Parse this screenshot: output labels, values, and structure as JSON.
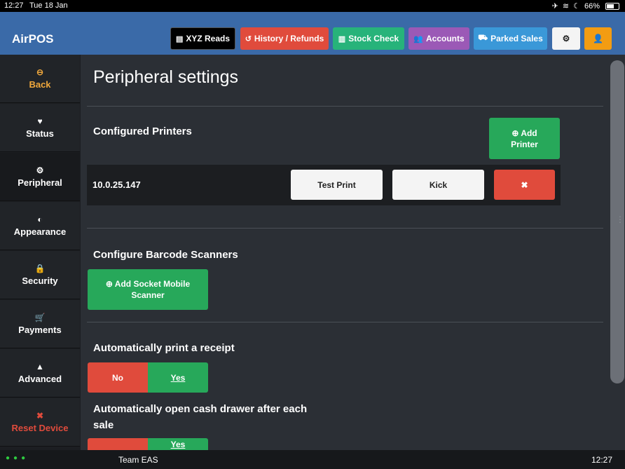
{
  "statusbar": {
    "time": "12:27",
    "date": "Tue 18 Jan",
    "battery": "66%"
  },
  "navbar": {
    "brand": "AirPOS",
    "buttons": [
      {
        "label": "XYZ Reads",
        "color": "#000000"
      },
      {
        "label": "History / Refunds",
        "color": "#e04b3c"
      },
      {
        "label": "Stock Check",
        "color": "#27b37a"
      },
      {
        "label": "Accounts",
        "color": "#9b59b6"
      },
      {
        "label": "Parked Sales",
        "color": "#3a98d8"
      }
    ]
  },
  "sidebar": {
    "items": [
      {
        "label": "Back",
        "icon": "circle-arrow-icon"
      },
      {
        "label": "Status",
        "icon": "heartbeat-icon"
      },
      {
        "label": "Peripheral",
        "icon": "gear-icon"
      },
      {
        "label": "Appearance",
        "icon": "half-circle-icon"
      },
      {
        "label": "Security",
        "icon": "lock-icon"
      },
      {
        "label": "Payments",
        "icon": "cart-icon"
      },
      {
        "label": "Advanced",
        "icon": "warning-icon"
      },
      {
        "label": "Reset Device",
        "icon": "close-icon"
      }
    ]
  },
  "main": {
    "title": "Peripheral settings",
    "printers": {
      "heading": "Configured Printers",
      "add_label_1": "Add",
      "add_label_2": "Printer",
      "rows": [
        {
          "ip": "10.0.25.147",
          "test_label": "Test Print",
          "kick_label": "Kick"
        }
      ]
    },
    "scanners": {
      "heading": "Configure Barcode Scanners",
      "add_label_1": "Add Socket Mobile",
      "add_label_2": "Scanner"
    },
    "auto_receipt": {
      "heading": "Automatically print a receipt",
      "no": "No",
      "yes": "Yes"
    },
    "auto_drawer": {
      "heading_1": "Automatically open cash drawer after each",
      "heading_2": "sale",
      "yes": "Yes"
    }
  },
  "footer": {
    "team": "Team EAS",
    "time": "12:27"
  }
}
